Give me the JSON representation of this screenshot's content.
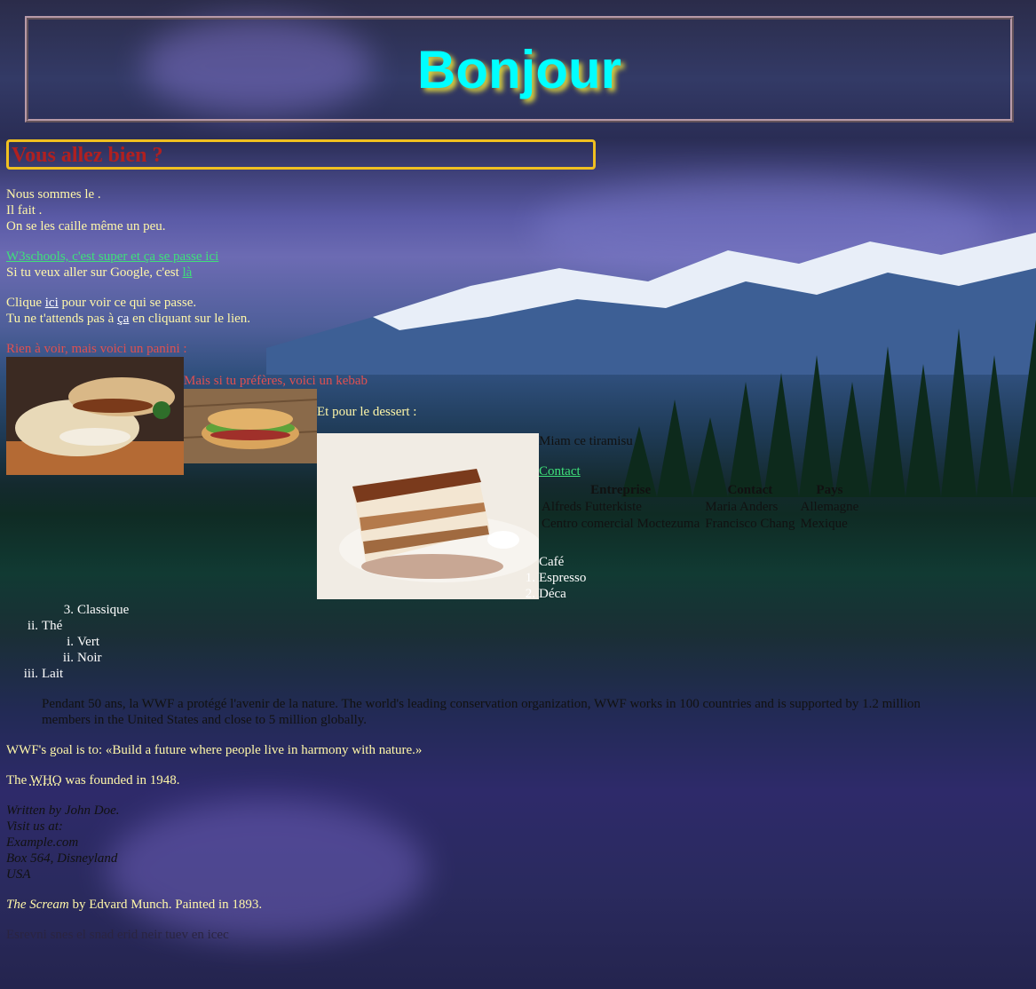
{
  "header": {
    "title": "Bonjour"
  },
  "subtitle": "Vous allez bien ?",
  "intro": {
    "line1": "Nous sommes le .",
    "line2": "Il fait .",
    "line3": "On se les caille même un peu."
  },
  "links": {
    "w3schools": "W3schools, c'est super et ça se passe ici",
    "google_prefix": "Si tu veux aller sur Google, c'est ",
    "google_link": "là",
    "click_prefix": "Clique ",
    "click_link": "ici",
    "click_suffix": " pour voir ce qui se passe.",
    "expect_prefix": "Tu ne t'attends pas à ",
    "expect_link": "ça",
    "expect_suffix": " en cliquant sur le lien."
  },
  "food": {
    "panini_caption": "Rien à voir, mais voici un panini :",
    "kebab_caption": "Mais si tu préfères, voici un kebab",
    "dessert_caption": "Et pour le dessert :",
    "tiramisu_caption": "Miam ce tiramisu",
    "contact_link": "Contact"
  },
  "table": {
    "headers": [
      "Entreprise",
      "Contact",
      "Pays"
    ],
    "rows": [
      [
        "Alfreds Futterkiste",
        "Maria Anders",
        "Allemagne"
      ],
      [
        "Centro comercial Moctezuma",
        "Francisco Chang",
        "Mexique"
      ]
    ]
  },
  "drinks": {
    "cafe": "Café",
    "espresso_marker": "1.",
    "espresso": "Espresso",
    "deca_marker": "2.",
    "deca": "Déca",
    "classique_marker": "3.",
    "classique": "Classique",
    "the_marker": "ii.",
    "the": "Thé",
    "vert_marker": "i.",
    "vert": "Vert",
    "noir_marker": "ii.",
    "noir": "Noir",
    "lait_marker": "iii.",
    "lait": "Lait"
  },
  "quote": {
    "blockquote_line1": "Pendant 50 ans, la WWF a protégé l'avenir de la nature. The world's leading conservation organization, WWF works in 100 countries and is supported by 1.2 million",
    "blockquote_line2": "members in the United States and close to 5 million globally.",
    "goal": "WWF's goal is to: «Build a future where people live in harmony with nature.»",
    "who_prefix": "The ",
    "who_abbr": "WHO",
    "who_suffix": " was founded in 1948."
  },
  "address": {
    "line1": "Written by John Doe.",
    "line2": "Visit us at:",
    "line3": "Example.com",
    "line4": "Box 564, Disneyland",
    "line5": "USA"
  },
  "scream": {
    "title": "The Scream",
    "rest": " by Edvard Munch. Painted in 1893."
  },
  "reversed": "Esrevni snes el snad erid neir tuev en icec"
}
